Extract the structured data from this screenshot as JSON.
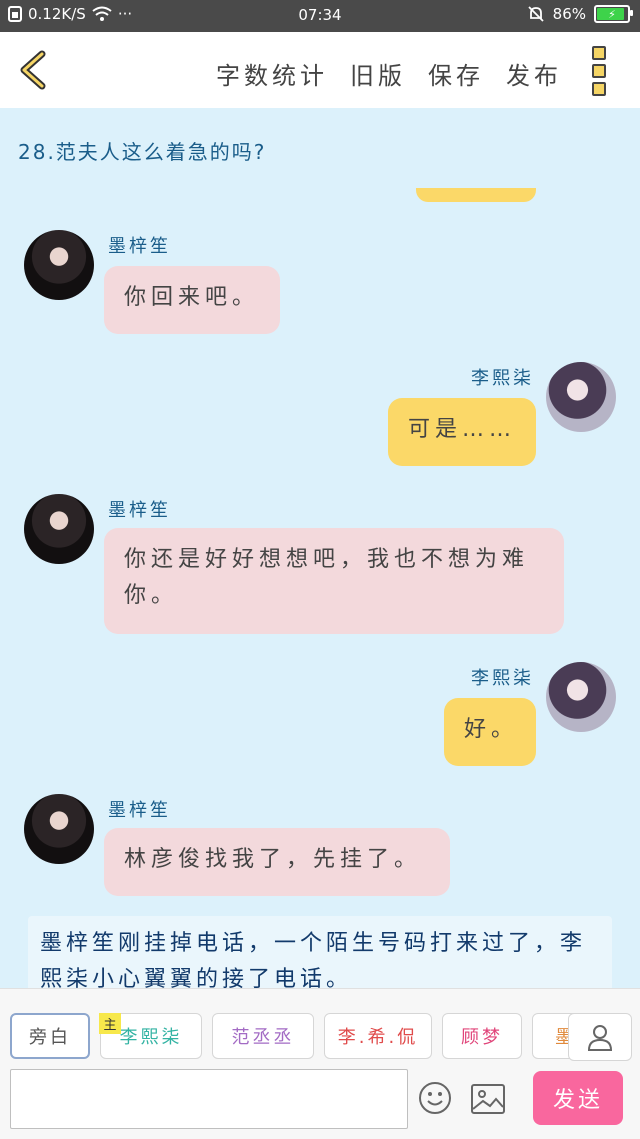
{
  "status_bar": {
    "network_speed": "0.12K/S",
    "more": "···",
    "time": "07:34",
    "battery": "86%"
  },
  "header": {
    "actions": [
      {
        "label": "字数统计"
      },
      {
        "label": "旧版"
      },
      {
        "label": "保存"
      },
      {
        "label": "发布"
      }
    ]
  },
  "chat": {
    "chapter_title": "28.范夫人这么着急的吗?",
    "messages": [
      {
        "speaker": "墨梓笙",
        "side": "left",
        "text": "你回来吧。"
      },
      {
        "speaker": "李熙柒",
        "side": "right",
        "text": "可是……"
      },
      {
        "speaker": "墨梓笙",
        "side": "left",
        "text": "你还是好好想想吧，我也不想为难你。"
      },
      {
        "speaker": "李熙柒",
        "side": "right",
        "text": "好。"
      },
      {
        "speaker": "墨梓笙",
        "side": "left",
        "text": "林彦俊找我了，先挂了。"
      }
    ],
    "narration": "墨梓笙刚挂掉电话，一个陌生号码打来过了，李熙柒小心翼翼的接了电话。"
  },
  "roles": {
    "items": [
      {
        "label": "旁白",
        "color": "#555555"
      },
      {
        "label": "李熙柒",
        "color": "#33b3a3",
        "tag": "主"
      },
      {
        "label": "范丞丞",
        "color": "#a36bc4"
      },
      {
        "label": "李.希.侃",
        "color": "#e04b4b"
      },
      {
        "label": "顾梦",
        "color": "#e0457a"
      },
      {
        "label": "墨",
        "color": "#e08a3c"
      }
    ]
  },
  "composer": {
    "input_value": "",
    "send_label": "发送"
  },
  "colors": {
    "background": "#dcf1fb",
    "left_bubble": "#f3d9dc",
    "right_bubble": "#fbd868",
    "send_button": "#f9679e"
  },
  "icons": [
    "back-arrow-icon",
    "menu-icon",
    "emoji-icon",
    "image-icon",
    "person-icon",
    "wifi-icon",
    "bell-icon",
    "battery-icon"
  ]
}
